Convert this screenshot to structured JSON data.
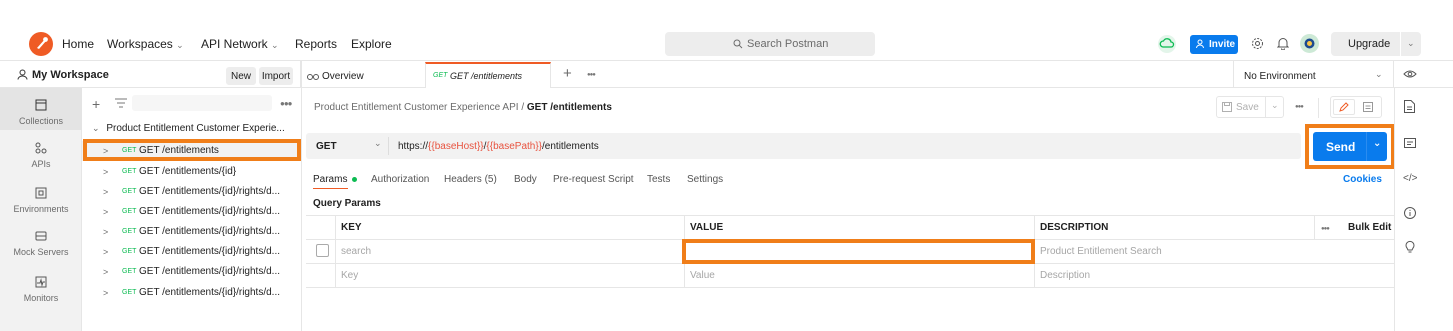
{
  "topbar": {
    "nav": [
      "Home",
      "Workspaces",
      "API Network",
      "Reports",
      "Explore"
    ],
    "search_placeholder": "Search Postman",
    "invite_label": "Invite",
    "upgrade_label": "Upgrade",
    "icons": [
      "postman-logo-icon",
      "cloud-sync-icon",
      "settings-icon",
      "bell-icon",
      "avatar"
    ]
  },
  "workspace": {
    "title": "My Workspace",
    "new_label": "New",
    "import_label": "Import"
  },
  "rail": {
    "items": [
      "Collections",
      "APIs",
      "Environments",
      "Mock Servers",
      "Monitors"
    ]
  },
  "sidebar": {
    "collection_name": "Product Entitlement Customer Experie...",
    "requests": [
      {
        "method": "GET",
        "path": "GET /entitlements"
      },
      {
        "method": "GET",
        "path": "GET /entitlements/{id}"
      },
      {
        "method": "GET",
        "path": "GET /entitlements/{id}/rights/d..."
      },
      {
        "method": "GET",
        "path": "GET /entitlements/{id}/rights/d..."
      },
      {
        "method": "GET",
        "path": "GET /entitlements/{id}/rights/d..."
      },
      {
        "method": "GET",
        "path": "GET /entitlements/{id}/rights/d..."
      },
      {
        "method": "GET",
        "path": "GET /entitlements/{id}/rights/d..."
      },
      {
        "method": "GET",
        "path": "GET /entitlements/{id}/rights/d..."
      }
    ]
  },
  "tabs": {
    "overview": "Overview",
    "active_method": "GET",
    "active_name": "GET /entitlements",
    "environment": "No Environment"
  },
  "request": {
    "breadcrumb_parent": "Product Entitlement Customer Experience API",
    "breadcrumb_sep": "/",
    "breadcrumb_current": "GET /entitlements",
    "save_label": "Save",
    "method": "GET",
    "url_prefix": "https://",
    "url_var1": "{{baseHost}}",
    "url_slash": "/",
    "url_var2": "{{basePath}}",
    "url_suffix": "/entitlements",
    "send_label": "Send",
    "subtabs": [
      "Params",
      "Authorization",
      "Headers (5)",
      "Body",
      "Pre-request Script",
      "Tests",
      "Settings"
    ],
    "cookies_label": "Cookies",
    "query_params_label": "Query Params",
    "columns": [
      "KEY",
      "VALUE",
      "DESCRIPTION"
    ],
    "bulk_edit_label": "Bulk Edit",
    "rows": [
      {
        "key": "search",
        "value": "",
        "description": "Product Entitlement Search"
      }
    ],
    "placeholder_row": {
      "key": "Key",
      "value": "Value",
      "description": "Description"
    }
  },
  "colors": {
    "accent": "#097bed",
    "highlight": "#f07e19",
    "get_method": "#0cbb52",
    "variable": "#e8533f",
    "logo": "#ef5b25"
  }
}
